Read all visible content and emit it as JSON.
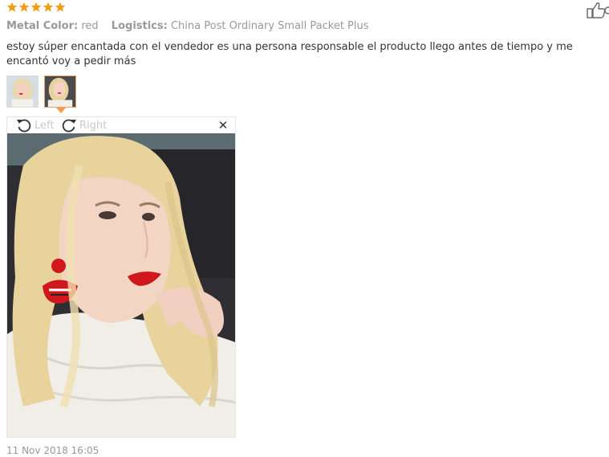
{
  "rating": {
    "stars": 5,
    "star_color": "#f39c12"
  },
  "attributes": [
    {
      "label": "Metal Color:",
      "value": "red"
    },
    {
      "label": "Logistics:",
      "value": "China Post Ordinary Small Packet Plus"
    }
  ],
  "review": {
    "text": "estoy súper encantada con el vendedor es una persona responsable el producto llego antes de tiempo y me encantó voy a pedir más"
  },
  "photos": {
    "count": 2,
    "selected_index": 1,
    "selected_border_color": "#e5a36a"
  },
  "viewer": {
    "rotate_left_label": "Left",
    "rotate_right_label": "Right",
    "close_glyph": "✕"
  },
  "icons": {
    "helpful": "thumbs-up-icon",
    "rotate_left": "rotate-left-icon",
    "rotate_right": "rotate-right-icon",
    "close": "close-icon",
    "star": "star-icon"
  },
  "timestamp": "11 Nov 2018 16:05"
}
